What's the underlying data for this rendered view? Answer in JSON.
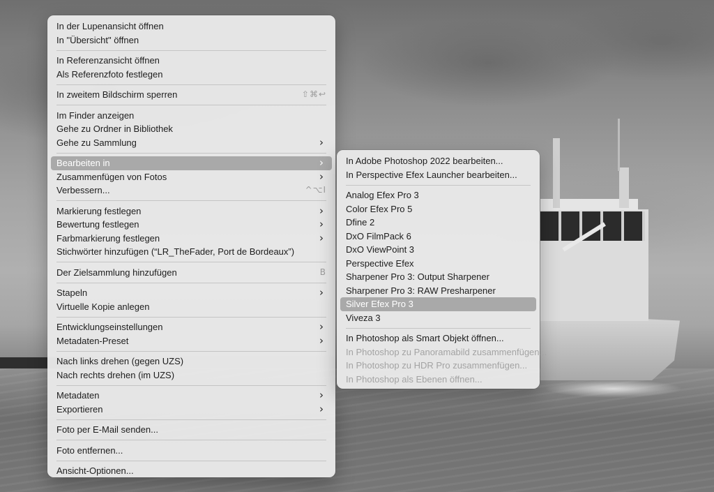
{
  "main_menu": {
    "groups": [
      [
        {
          "label": "In der Lupenansicht öffnen"
        },
        {
          "label": "In \"Übersicht\" öffnen"
        }
      ],
      [
        {
          "label": "In Referenzansicht öffnen"
        },
        {
          "label": "Als Referenzfoto festlegen"
        }
      ],
      [
        {
          "label": "In zweitem Bildschirm sperren",
          "shortcut": "⇧⌘↩"
        }
      ],
      [
        {
          "label": "Im Finder anzeigen"
        },
        {
          "label": "Gehe zu Ordner in Bibliothek"
        },
        {
          "label": "Gehe zu Sammlung",
          "submenu": true
        }
      ],
      [
        {
          "label": "Bearbeiten in",
          "submenu": true,
          "highlighted": true
        },
        {
          "label": "Zusammenfügen von Fotos",
          "submenu": true
        },
        {
          "label": "Verbessern...",
          "shortcut": "^⌥I"
        }
      ],
      [
        {
          "label": "Markierung festlegen",
          "submenu": true
        },
        {
          "label": "Bewertung festlegen",
          "submenu": true
        },
        {
          "label": "Farbmarkierung festlegen",
          "submenu": true
        },
        {
          "label": "Stichwörter hinzufügen (“LR_TheFader, Port de Bordeaux”)"
        }
      ],
      [
        {
          "label": "Der Zielsammlung hinzufügen",
          "shortcut": "B"
        }
      ],
      [
        {
          "label": "Stapeln",
          "submenu": true
        },
        {
          "label": "Virtuelle Kopie anlegen"
        }
      ],
      [
        {
          "label": "Entwicklungseinstellungen",
          "submenu": true
        },
        {
          "label": "Metadaten-Preset",
          "submenu": true
        }
      ],
      [
        {
          "label": "Nach links drehen (gegen UZS)"
        },
        {
          "label": "Nach rechts drehen (im UZS)"
        }
      ],
      [
        {
          "label": "Metadaten",
          "submenu": true
        },
        {
          "label": "Exportieren",
          "submenu": true
        }
      ],
      [
        {
          "label": "Foto per E-Mail senden..."
        }
      ],
      [
        {
          "label": "Foto entfernen..."
        }
      ],
      [
        {
          "label": "Ansicht-Optionen..."
        }
      ]
    ]
  },
  "sub_menu": {
    "groups": [
      [
        {
          "label": "In Adobe Photoshop 2022 bearbeiten..."
        },
        {
          "label": "In Perspective Efex Launcher bearbeiten..."
        }
      ],
      [
        {
          "label": "Analog Efex Pro 3"
        },
        {
          "label": "Color Efex Pro 5"
        },
        {
          "label": "Dfine 2"
        },
        {
          "label": "DxO FilmPack 6"
        },
        {
          "label": "DxO ViewPoint 3"
        },
        {
          "label": "Perspective Efex"
        },
        {
          "label": "Sharpener Pro 3: Output Sharpener"
        },
        {
          "label": "Sharpener Pro 3: RAW Presharpener"
        },
        {
          "label": "Silver Efex Pro 3",
          "highlighted": true
        },
        {
          "label": "Viveza 3"
        }
      ],
      [
        {
          "label": "In Photoshop als Smart Objekt öffnen..."
        },
        {
          "label": "In Photoshop zu Panoramabild zusammenfügen...",
          "disabled": true
        },
        {
          "label": "In Photoshop zu HDR Pro zusammenfügen...",
          "disabled": true
        },
        {
          "label": "In Photoshop als Ebenen öffnen...",
          "disabled": true
        }
      ]
    ]
  },
  "icons": {
    "submenu_chevron": "chevron-right-icon",
    "submenu_glyph": "›"
  }
}
